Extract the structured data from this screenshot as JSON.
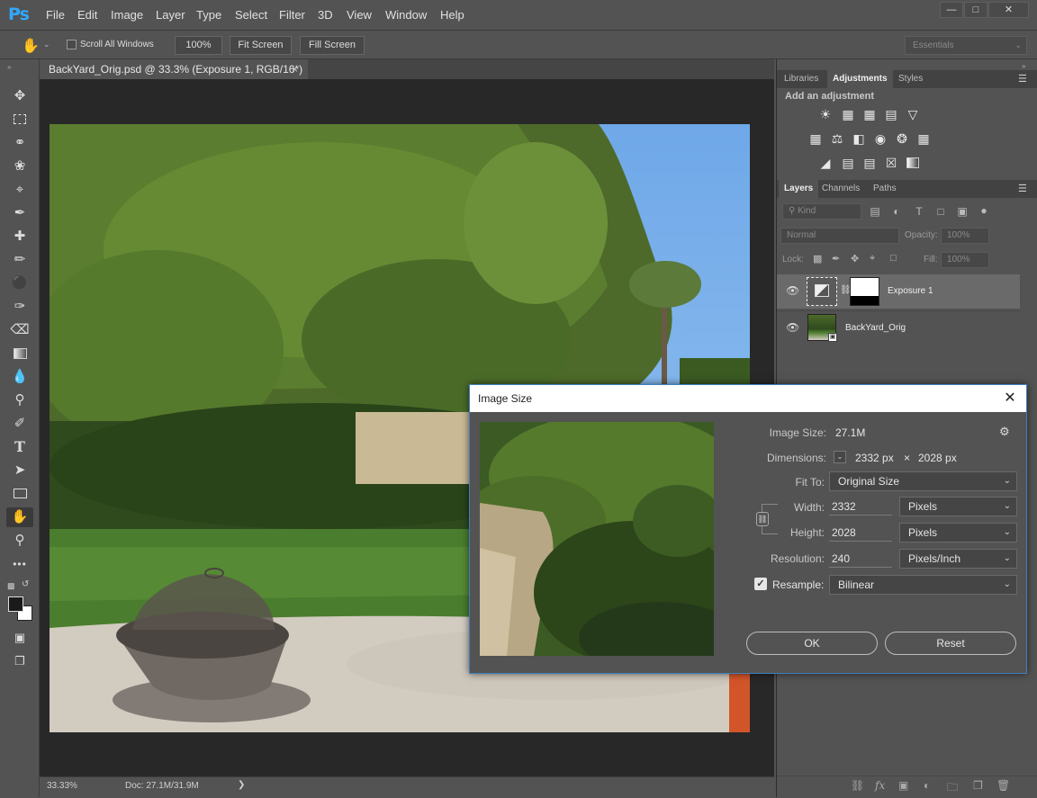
{
  "app": {
    "logo": "Ps"
  },
  "menu": [
    "File",
    "Edit",
    "Image",
    "Layer",
    "Type",
    "Select",
    "Filter",
    "3D",
    "View",
    "Window",
    "Help"
  ],
  "window_controls": {
    "minimize": "—",
    "maximize": "□",
    "close": "✕"
  },
  "options": {
    "scroll_all_windows": "Scroll All Windows",
    "zoom_button": "100%",
    "fit_screen": "Fit Screen",
    "fill_screen": "Fill Screen",
    "workspace": "Essentials"
  },
  "document": {
    "tab_title": "BackYard_Orig.psd @ 33.3% (Exposure 1, RGB/16*)",
    "tab_close": "×"
  },
  "status": {
    "zoom": "33.33%",
    "doc": "Doc: 27.1M/31.9M",
    "arrow": "❯"
  },
  "panels": {
    "top_tabs": [
      "Libraries",
      "Adjustments",
      "Styles"
    ],
    "adjustments_title": "Add an adjustment",
    "layer_tabs": [
      "Layers",
      "Channels",
      "Paths"
    ],
    "kind_filter": "Kind",
    "blend_mode": "Normal",
    "opacity_label": "Opacity:",
    "opacity_value": "100%",
    "lock_label": "Lock:",
    "fill_label": "Fill:",
    "fill_value": "100%",
    "layers": [
      {
        "name": "Exposure 1"
      },
      {
        "name": "BackYard_Orig"
      }
    ]
  },
  "dialog": {
    "title": "Image Size",
    "close": "✕",
    "image_size_label": "Image Size:",
    "image_size_value": "27.1M",
    "dimensions_label": "Dimensions:",
    "dim_width": "2332 px",
    "dim_times": "×",
    "dim_height": "2028 px",
    "fit_to_label": "Fit To:",
    "fit_to_value": "Original Size",
    "width_label": "Width:",
    "width_value": "2332",
    "width_unit": "Pixels",
    "height_label": "Height:",
    "height_value": "2028",
    "height_unit": "Pixels",
    "resolution_label": "Resolution:",
    "resolution_value": "240",
    "resolution_unit": "Pixels/Inch",
    "resample_label": "Resample:",
    "resample_value": "Bilinear",
    "resample_checked": true,
    "ok": "OK",
    "reset": "Reset"
  },
  "colors": {
    "accent": "#31a8ff",
    "dialog_border": "#3f7fbf"
  }
}
